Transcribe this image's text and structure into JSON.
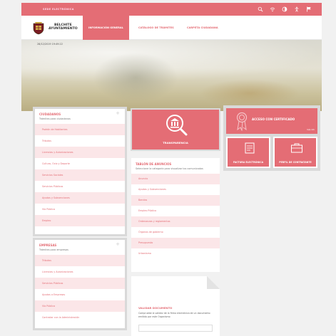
{
  "topbar": {
    "site_label": "SEDE ELECTRÓNICA",
    "icons": [
      "search-icon",
      "wifi-icon",
      "contrast-icon",
      "accessibility-icon",
      "flag-icon"
    ]
  },
  "nav": {
    "brand_line1": "BELCHITE",
    "brand_line2": "AYUNTAMIENTO",
    "tabs": [
      "INFORMACIÓN GENERAL",
      "CATÁLOGO DE TRÁMITES",
      "CARPETA CIUDADANA"
    ]
  },
  "hero": {
    "datetime": "28/12/2019 19:49:22"
  },
  "ciudadanos": {
    "title": "CIUDADANOS",
    "subtitle": "Trámites para ciudadanos",
    "items": [
      "Padrón de Habitantes",
      "Tributos",
      "Licencias y Autorizaciones",
      "Cultura, Ocio y Deporte",
      "Servicios Sociales",
      "Servicios Públicos",
      "Ayudas y Subvenciones",
      "Vía Pública",
      "Empleo"
    ]
  },
  "empresas": {
    "title": "EMPRESAS",
    "subtitle": "Trámites para empresas",
    "items": [
      "Tributos",
      "Licencias y Autorizaciones",
      "Servicios Públicos",
      "Ayudas a Empresas",
      "Vía Pública",
      "Contratar con la Administración"
    ]
  },
  "transparencia": {
    "label": "TRANSPARENCIA"
  },
  "tablon": {
    "title": "TABLÓN DE ANUNCIOS",
    "subtitle": "Seleccione la categoría para visualizar los comunicados",
    "items": [
      "Anuncio",
      "Ayudas y Subvenciones",
      "Bandos",
      "Empleo Público",
      "Ordenanzas y reglamentos",
      "Órganos de gobierno",
      "Presupuesto",
      "Urbanismo"
    ]
  },
  "validar": {
    "title": "VALIDAR DOCUMENTO",
    "description": "Compruebe la validez de la firma electrónica de un documento emitido por este Organismo"
  },
  "acceso": {
    "label": "ACCESO CON CERTIFICADO",
    "more": "más info"
  },
  "tiles": [
    {
      "label": "FACTURA ELECTRÓNICA"
    },
    {
      "label": "PERFIL DE CONTRATANTE"
    }
  ],
  "colors": {
    "accent": "#e46d75",
    "accent_light": "#fbe6e8",
    "panel_border": "#d9d9d9"
  }
}
